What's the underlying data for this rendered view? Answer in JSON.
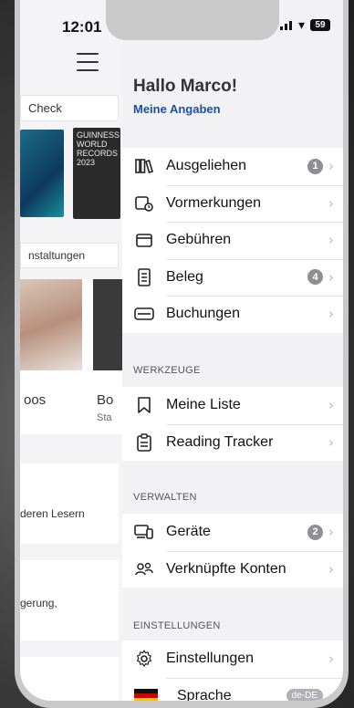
{
  "status": {
    "time": "12:01",
    "battery": "59"
  },
  "background": {
    "check_label": "Check",
    "events_label": "nstaltungen",
    "card1_text": "oos",
    "card2_title": "Bo",
    "card2_sub": "Sta",
    "readers_text": "deren Lesern",
    "text2": "gerung,",
    "book_title": "GUINNESS WORLD RECORDS 2023"
  },
  "drawer": {
    "greeting": "Hallo Marco!",
    "profile_link": "Meine Angaben",
    "account_items": [
      {
        "label": "Ausgeliehen",
        "badge": "1",
        "icon": "books-icon"
      },
      {
        "label": "Vormerkungen",
        "badge": "",
        "icon": "reservation-icon"
      },
      {
        "label": "Gebühren",
        "badge": "",
        "icon": "fees-icon"
      },
      {
        "label": "Beleg",
        "badge": "4",
        "icon": "receipt-icon"
      },
      {
        "label": "Buchungen",
        "badge": "",
        "icon": "ticket-icon"
      }
    ],
    "tools_header": "WERKZEUGE",
    "tools_items": [
      {
        "label": "Meine Liste",
        "icon": "bookmark-icon"
      },
      {
        "label": "Reading Tracker",
        "icon": "tracker-icon"
      }
    ],
    "manage_header": "VERWALTEN",
    "manage_items": [
      {
        "label": "Geräte",
        "badge": "2",
        "icon": "devices-icon"
      },
      {
        "label": "Verknüpfte Konten",
        "badge": "",
        "icon": "linked-accounts-icon"
      }
    ],
    "settings_header": "EINSTELLUNGEN",
    "settings_items": [
      {
        "label": "Einstellungen",
        "icon": "gear-icon"
      },
      {
        "label": "Sprache",
        "badge": "de-DE",
        "icon": "flag-de-icon"
      }
    ]
  }
}
